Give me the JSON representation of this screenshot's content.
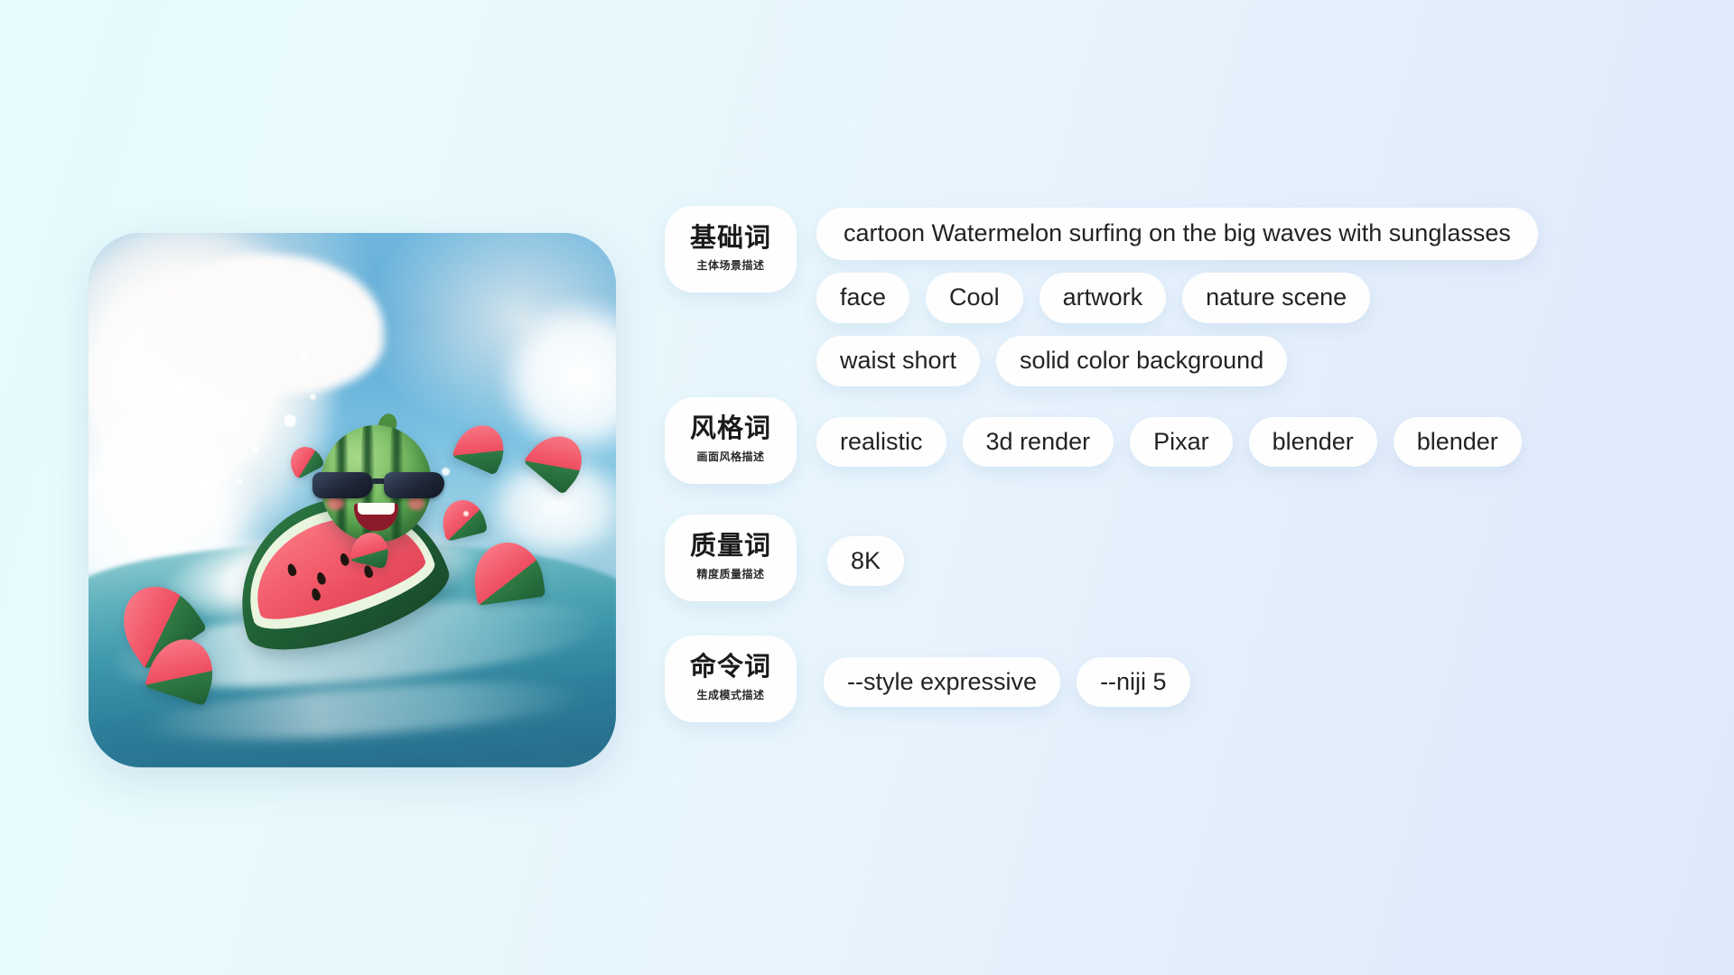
{
  "background": {
    "gradient_from": "#e6fbfd",
    "gradient_to": "#dfe9fb"
  },
  "preview": {
    "alt": "3D cartoon watermelon character wearing sunglasses surfing a watermelon slice on ocean waves",
    "corner_radius": "58px"
  },
  "categories": [
    {
      "id": "base",
      "title": "基础词",
      "subtitle": "主体场景描述",
      "rows": [
        [
          "cartoon Watermelon surfing on the big waves with sunglasses"
        ],
        [
          "face",
          "Cool",
          "artwork",
          "nature scene"
        ],
        [
          "waist short",
          "solid color background"
        ]
      ]
    },
    {
      "id": "style",
      "title": "风格词",
      "subtitle": "画面风格描述",
      "rows": [
        [
          "realistic",
          "3d render",
          "Pixar",
          "blender",
          "blender"
        ]
      ]
    },
    {
      "id": "quality",
      "title": "质量词",
      "subtitle": "精度质量描述",
      "rows": [
        [
          "8K"
        ]
      ]
    },
    {
      "id": "command",
      "title": "命令词",
      "subtitle": "生成模式描述",
      "rows": [
        [
          "--style expressive",
          "--niji 5"
        ]
      ]
    }
  ]
}
